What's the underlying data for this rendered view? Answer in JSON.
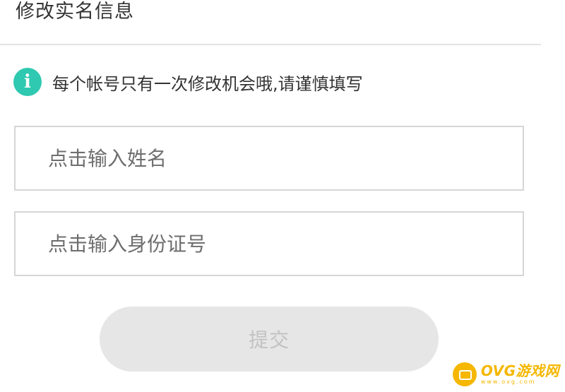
{
  "header": {
    "title": "修改实名信息"
  },
  "notice": {
    "icon": "info-icon",
    "icon_glyph": "i",
    "text": "每个帐号只有一次修改机会哦,请谨慎填写",
    "accent_color": "#2ec9b0"
  },
  "form": {
    "name_field": {
      "value": "",
      "placeholder": "点击输入姓名"
    },
    "id_field": {
      "value": "",
      "placeholder": "点击输入身份证号"
    },
    "submit_label": "提交"
  },
  "watermark": {
    "icon": "gamepad-logo-icon",
    "title": "OVG游戏网",
    "subtitle": "www.ovg.com",
    "color": "#f5b700"
  }
}
